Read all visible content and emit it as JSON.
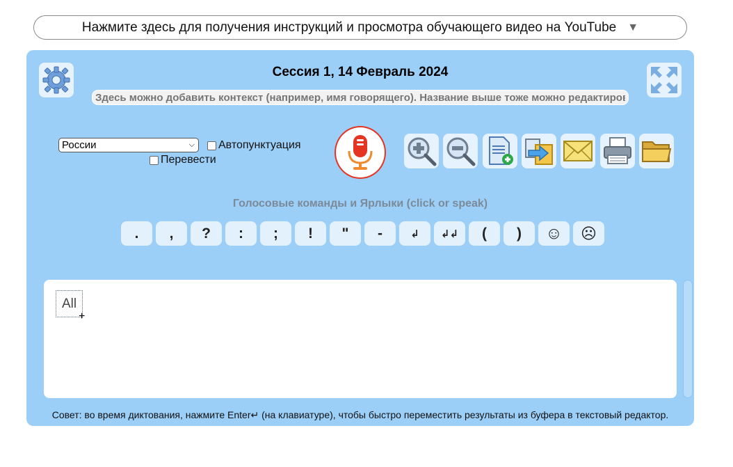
{
  "instructions": {
    "label": "Нажмите здесь для получения инструкций и просмотра обучающего видео на YouTube",
    "arrow": "▼"
  },
  "session": {
    "title": "Сессия 1, 14 Февраль 2024",
    "context_placeholder": "Здесь можно добавить контекст (например, имя говорящего). Название выше тоже можно редактировать"
  },
  "language": {
    "selected": "России"
  },
  "options": {
    "autopunct_label": "Автопунктуация",
    "translate_label": "Перевести"
  },
  "commands": {
    "title": "Голосовые команды и Ярлыки (click or speak)",
    "buttons": [
      ".",
      ",",
      "?",
      ":",
      ";",
      "!",
      "\"",
      "-",
      "↲",
      "↲↲",
      "(",
      ")",
      "☺",
      "☹"
    ]
  },
  "editor": {
    "chip_text": "All",
    "cursor": "+"
  },
  "tip": "Совет: во время диктования, нажмите Enter↵ (на клавиатуре), чтобы быстро переместить результаты из буфера в текстовый редактор.",
  "colors": {
    "panel": "#9ccff8",
    "mic_accent": "#e53421"
  },
  "icons": [
    "gear-icon",
    "fullscreen-icon",
    "microphone-icon",
    "zoom-in-icon",
    "zoom-out-icon",
    "new-document-icon",
    "export-icon",
    "email-icon",
    "printer-icon",
    "folder-icon"
  ]
}
